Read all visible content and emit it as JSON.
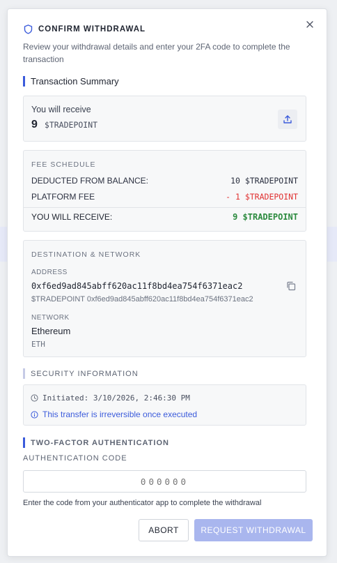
{
  "modal": {
    "title": "CONFIRM WITHDRAWAL",
    "description": "Review your withdrawal details and enter your 2FA code to complete the transaction"
  },
  "summary": {
    "heading": "Transaction Summary",
    "receive_label": "You will receive",
    "amount": "9",
    "token": "$TRADEPOINT"
  },
  "fees": {
    "heading": "FEE SCHEDULE",
    "deducted_label": "DEDUCTED FROM BALANCE:",
    "deducted_value": "10 $TRADEPOINT",
    "platform_label": "PLATFORM FEE",
    "platform_value": "- 1 $TRADEPOINT",
    "receive_label": "YOU WILL RECEIVE:",
    "receive_value": "9 $TRADEPOINT"
  },
  "destination": {
    "heading": "DESTINATION & NETWORK",
    "address_label": "ADDRESS",
    "address": "0xf6ed9ad845abff620ac11f8bd4ea754f6371eac2",
    "address_sub": "$TRADEPOINT 0xf6ed9ad845abff620ac11f8bd4ea754f6371eac2",
    "network_label": "NETWORK",
    "network": "Ethereum",
    "network_code": "ETH"
  },
  "security": {
    "heading": "SECURITY INFORMATION",
    "initiated": "Initiated: 3/10/2026, 2:46:30 PM",
    "warning": "This transfer is irreversible once executed"
  },
  "twofa": {
    "heading": "TWO-FACTOR AUTHENTICATION",
    "code_label": "AUTHENTICATION CODE",
    "placeholder": "000000",
    "help": "Enter the code from your authenticator app to complete the withdrawal"
  },
  "actions": {
    "abort": "ABORT",
    "request": "REQUEST WITHDRAWAL"
  },
  "colors": {
    "accent": "#3b5bdb",
    "fee_red": "#e03131",
    "receive_green": "#2b8a3e",
    "disabled_button": "#a9b6ee"
  }
}
